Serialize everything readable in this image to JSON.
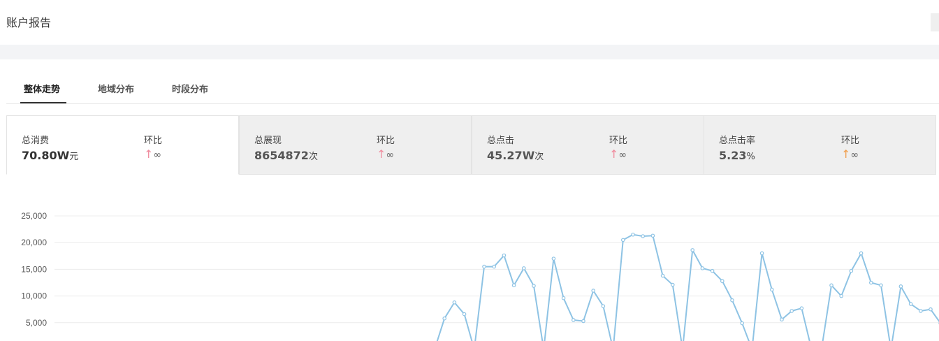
{
  "page": {
    "title": "账户报告"
  },
  "tabs": [
    {
      "label": "整体走势",
      "active": true
    },
    {
      "label": "地域分布",
      "active": false
    },
    {
      "label": "时段分布",
      "active": false
    }
  ],
  "metrics": [
    {
      "label": "总消费",
      "value": "70.80W",
      "unit": "元",
      "compare_label": "环比",
      "compare_arrow": "↑",
      "compare_value": "∞",
      "arrow_color": "#f08c9e"
    },
    {
      "label": "总展现",
      "value": "8654872",
      "unit": "次",
      "compare_label": "环比",
      "compare_arrow": "↑",
      "compare_value": "∞",
      "arrow_color": "#f08c9e"
    },
    {
      "label": "总点击",
      "value": "45.27W",
      "unit": "次",
      "compare_label": "环比",
      "compare_arrow": "↑",
      "compare_value": "∞",
      "arrow_color": "#f08c9e"
    },
    {
      "label": "总点击率",
      "value": "5.23",
      "unit": "%",
      "compare_label": "环比",
      "compare_arrow": "↑",
      "compare_value": "∞",
      "arrow_color": "#f0a050"
    }
  ],
  "chart_data": {
    "type": "line",
    "yticks": [
      "25,000",
      "20,000",
      "15,000",
      "10,000",
      "5,000"
    ],
    "ylim": [
      0,
      25000
    ],
    "grid": true,
    "line_color": "#8ec3e4",
    "series": [
      {
        "values": [
          0,
          5800,
          8800,
          6600,
          0,
          15500,
          15500,
          17600,
          12000,
          15200,
          11900,
          0,
          17000,
          9600,
          5500,
          5300,
          11000,
          8100,
          0,
          20500,
          21500,
          21200,
          21300,
          13800,
          12100,
          0,
          18600,
          15200,
          14700,
          12800,
          9200,
          4900,
          0,
          18000,
          11200,
          5600,
          7200,
          7700,
          0,
          0,
          12000,
          10000,
          14700,
          18000,
          12500,
          12000,
          0,
          11800,
          8500,
          7200,
          7500,
          4900
        ]
      }
    ]
  }
}
